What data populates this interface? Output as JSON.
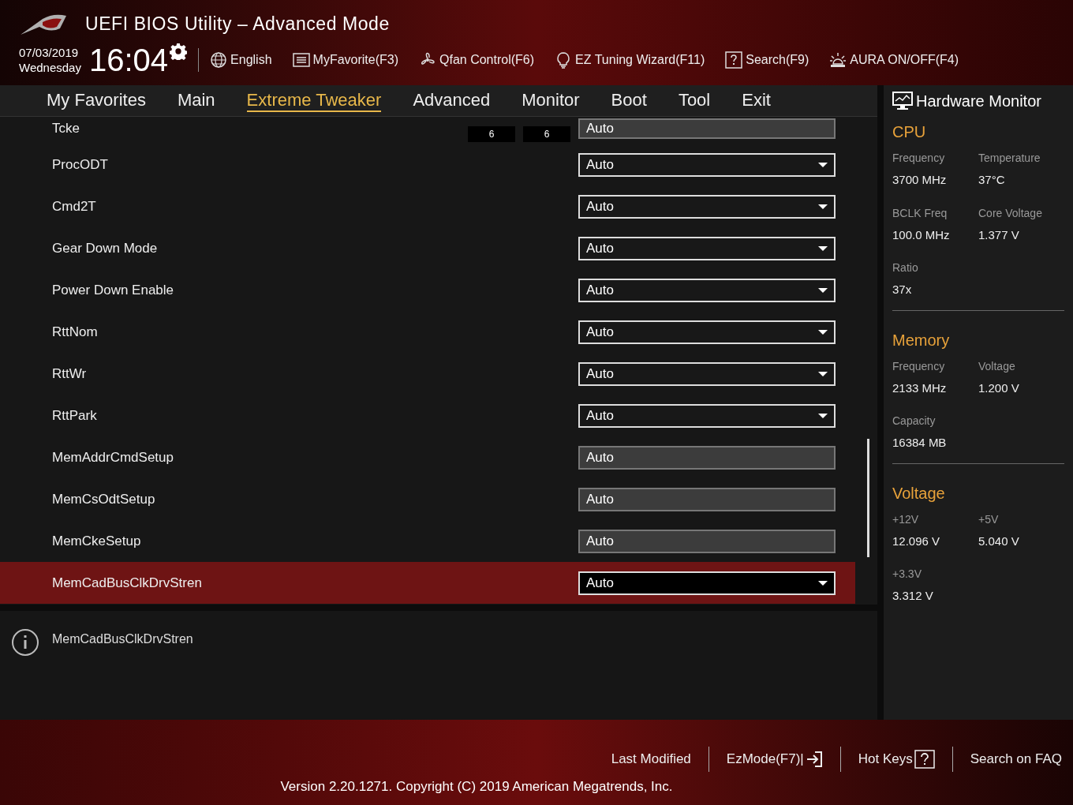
{
  "header": {
    "title": "UEFI BIOS Utility – Advanced Mode",
    "date": "07/03/2019",
    "weekday": "Wednesday",
    "time": "16:04",
    "tools": [
      {
        "kind": "language",
        "label": "English"
      },
      {
        "kind": "favorite",
        "label": "MyFavorite(F3)"
      },
      {
        "kind": "fan",
        "label": "Qfan Control(F6)"
      },
      {
        "kind": "wizard",
        "label": "EZ Tuning Wizard(F11)"
      },
      {
        "kind": "search",
        "label": "Search(F9)"
      },
      {
        "kind": "aura",
        "label": "AURA ON/OFF(F4)"
      }
    ]
  },
  "tabs": [
    {
      "label": "My Favorites",
      "selected": false
    },
    {
      "label": "Main",
      "selected": false
    },
    {
      "label": "Extreme Tweaker",
      "selected": true
    },
    {
      "label": "Advanced",
      "selected": false
    },
    {
      "label": "Monitor",
      "selected": false
    },
    {
      "label": "Boot",
      "selected": false
    },
    {
      "label": "Tool",
      "selected": false
    },
    {
      "label": "Exit",
      "selected": false
    }
  ],
  "settings": [
    {
      "label": "Tcke",
      "kind": "readonly",
      "value": "Auto",
      "readings": [
        "6",
        "6"
      ],
      "selected": false
    },
    {
      "label": "ProcODT",
      "kind": "dropdown",
      "value": "Auto",
      "selected": false
    },
    {
      "label": "Cmd2T",
      "kind": "dropdown",
      "value": "Auto",
      "selected": false
    },
    {
      "label": "Gear Down Mode",
      "kind": "dropdown",
      "value": "Auto",
      "selected": false
    },
    {
      "label": "Power Down Enable",
      "kind": "dropdown",
      "value": "Auto",
      "selected": false
    },
    {
      "label": "RttNom",
      "kind": "dropdown",
      "value": "Auto",
      "selected": false
    },
    {
      "label": "RttWr",
      "kind": "dropdown",
      "value": "Auto",
      "selected": false
    },
    {
      "label": "RttPark",
      "kind": "dropdown",
      "value": "Auto",
      "selected": false
    },
    {
      "label": "MemAddrCmdSetup",
      "kind": "readonly",
      "value": "Auto",
      "selected": false
    },
    {
      "label": "MemCsOdtSetup",
      "kind": "readonly",
      "value": "Auto",
      "selected": false
    },
    {
      "label": "MemCkeSetup",
      "kind": "readonly",
      "value": "Auto",
      "selected": false
    },
    {
      "label": "MemCadBusClkDrvStren",
      "kind": "dropdown",
      "value": "Auto",
      "selected": true
    }
  ],
  "help": {
    "text": "MemCadBusClkDrvStren"
  },
  "hardware_monitor": {
    "title": "Hardware Monitor",
    "sections": [
      {
        "title": "CPU",
        "items": [
          {
            "label": "Frequency",
            "value": "3700 MHz"
          },
          {
            "label": "Temperature",
            "value": "37°C"
          },
          {
            "label": "BCLK Freq",
            "value": "100.0 MHz"
          },
          {
            "label": "Core Voltage",
            "value": "1.377 V"
          },
          {
            "label": "Ratio",
            "value": "37x"
          }
        ]
      },
      {
        "title": "Memory",
        "items": [
          {
            "label": "Frequency",
            "value": "2133 MHz"
          },
          {
            "label": "Voltage",
            "value": "1.200 V"
          },
          {
            "label": "Capacity",
            "value": "16384 MB"
          }
        ]
      },
      {
        "title": "Voltage",
        "items": [
          {
            "label": "+12V",
            "value": "12.096 V"
          },
          {
            "label": "+5V",
            "value": "5.040 V"
          },
          {
            "label": "+3.3V",
            "value": "3.312 V"
          }
        ]
      }
    ]
  },
  "footer": {
    "actions": [
      {
        "kind": "plain",
        "label": "Last Modified"
      },
      {
        "kind": "exit",
        "label": "EzMode(F7)|"
      },
      {
        "kind": "help",
        "label": "Hot Keys"
      },
      {
        "kind": "plain",
        "label": "Search on FAQ"
      }
    ],
    "version": "Version 2.20.1271. Copyright (C) 2019 American Megatrends, Inc."
  }
}
